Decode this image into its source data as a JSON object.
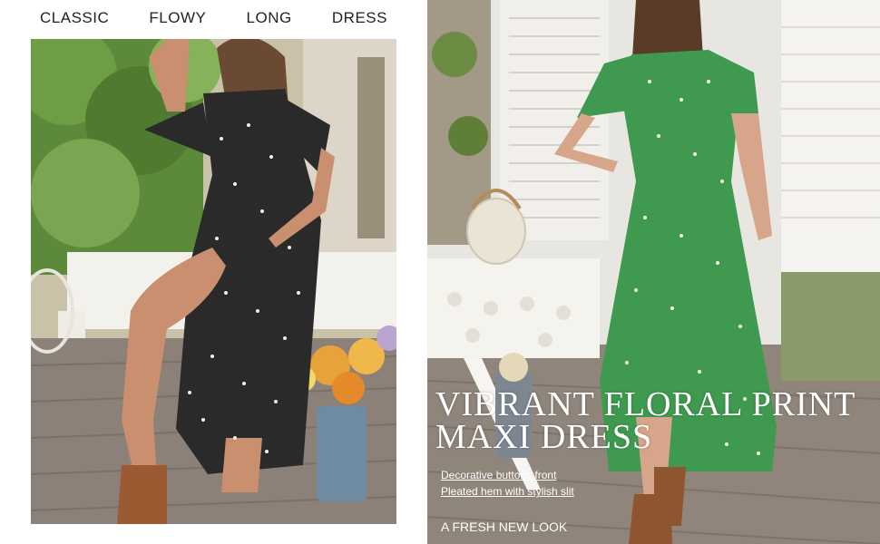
{
  "header_words": [
    "CLASSIC",
    "FLOWY",
    "LONG",
    "DRESS"
  ],
  "headline": {
    "line1": "VIBRANT FLORAL PRINT",
    "line2": "MAXI DRESS"
  },
  "features": [
    "Decorative buttons front",
    "Pleated hem with stylish slit"
  ],
  "tagline": "A FRESH NEW LOOK",
  "colors": {
    "left_dress": "#2a2a2a",
    "right_dress": "#3f9a4f",
    "deck": "#8b8178",
    "foliage": "#5d8a3a",
    "house_wall": "#e8e6e1"
  }
}
